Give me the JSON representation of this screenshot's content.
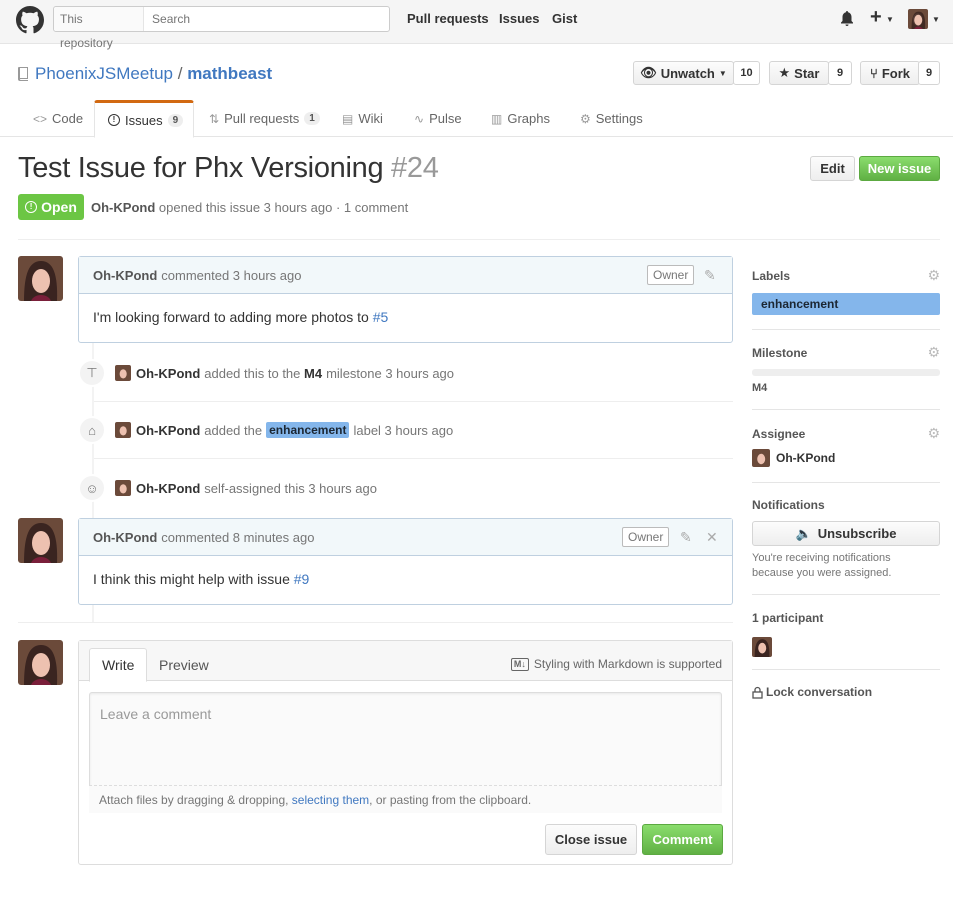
{
  "header": {
    "search_scope": "This repository",
    "search_placeholder": "Search",
    "nav": [
      "Pull requests",
      "Issues",
      "Gist"
    ],
    "plus": "+"
  },
  "repo": {
    "owner": "PhoenixJSMeetup",
    "separator": "/",
    "name": "mathbeast",
    "watch_label": "Unwatch",
    "watch_count": "10",
    "star_label": "Star",
    "star_count": "9",
    "fork_label": "Fork",
    "fork_count": "9"
  },
  "tabs": [
    {
      "label": "Code",
      "icon": "code-icon"
    },
    {
      "label": "Issues",
      "count": "9",
      "icon": "issue-icon"
    },
    {
      "label": "Pull requests",
      "count": "1",
      "icon": "pull-request-icon"
    },
    {
      "label": "Wiki",
      "icon": "book-icon"
    },
    {
      "label": "Pulse",
      "icon": "pulse-icon"
    },
    {
      "label": "Graphs",
      "icon": "graph-icon"
    },
    {
      "label": "Settings",
      "icon": "gear-icon"
    }
  ],
  "issue": {
    "title": "Test Issue for Phx Versioning",
    "number": "#24",
    "state": "Open",
    "author": "Oh-KPond",
    "meta_text": "opened this issue 3 hours ago · 1 comment",
    "edit_label": "Edit",
    "new_issue_label": "New issue"
  },
  "comments": [
    {
      "author": "Oh-KPond",
      "time": "commented 3 hours ago",
      "badge": "Owner",
      "body_text": "I'm looking forward to adding more photos to ",
      "body_link": "#5"
    },
    {
      "author": "Oh-KPond",
      "time": "commented 8 minutes ago",
      "badge": "Owner",
      "body_text": "I think this might help with issue ",
      "body_link": "#9"
    }
  ],
  "events": [
    {
      "actor": "Oh-KPond",
      "pre": "added this to the",
      "target": "M4",
      "post": "milestone 3 hours ago",
      "icon": "milestone-icon"
    },
    {
      "actor": "Oh-KPond",
      "pre": "added the",
      "label": "enhancement",
      "post": "label 3 hours ago",
      "icon": "tag-icon"
    },
    {
      "actor": "Oh-KPond",
      "text": "self-assigned this 3 hours ago",
      "icon": "person-icon"
    }
  ],
  "sidebar": {
    "labels_title": "Labels",
    "label": "enhancement",
    "label_color": "#84b6eb",
    "milestone_title": "Milestone",
    "milestone": "M4",
    "milestone_progress": 0,
    "assignee_title": "Assignee",
    "assignee": "Oh-KPond",
    "notifications_title": "Notifications",
    "unsubscribe_label": "Unsubscribe",
    "notifications_note_1": "You're receiving notifications",
    "notifications_note_2": "because you were assigned.",
    "participants": "1 participant",
    "lock_label": "Lock conversation"
  },
  "composer": {
    "write_tab": "Write",
    "preview_tab": "Preview",
    "markdown_note": "Styling with Markdown is supported",
    "placeholder": "Leave a comment",
    "attach_pre": "Attach files by dragging & dropping, ",
    "attach_link": "selecting them",
    "attach_post": ", or pasting from the clipboard.",
    "close_label": "Close issue",
    "comment_label": "Comment"
  },
  "colors": {
    "accent_green": "#6cc644",
    "link_blue": "#4078c0",
    "tab_active": "#d26911"
  }
}
